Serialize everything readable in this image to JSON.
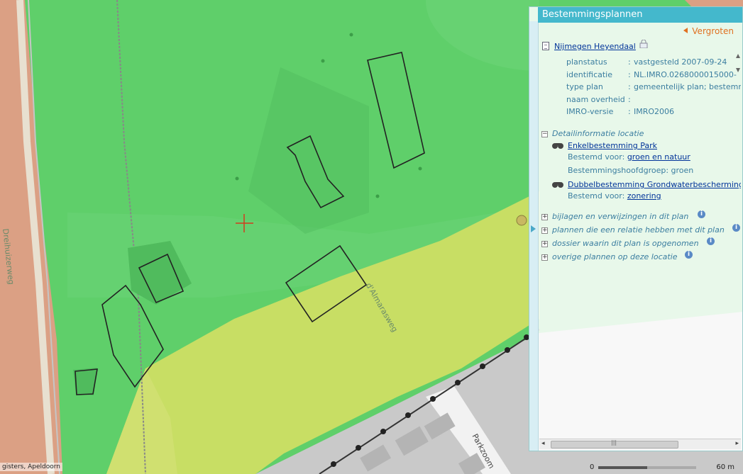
{
  "map": {
    "street_labels": [
      "Dreihuizerweg",
      "d'Almarasweg",
      "Parkzoom"
    ],
    "attribution": "gisters, Apeldoorn",
    "scale": {
      "start": "0",
      "end": "60 m"
    },
    "colors": {
      "park": "#5fcf6a",
      "road_band": "#55c868",
      "dubbel": "#c8de64",
      "residential": "#dba084",
      "road": "#c9c9c9"
    }
  },
  "panel": {
    "title": "Bestemmingsplannen",
    "expand_label": "Vergroten",
    "plan_name": "Nijmegen Heyendaal",
    "properties": [
      {
        "key": "planstatus",
        "sep": ":",
        "value": "vastgesteld 2007-09-24"
      },
      {
        "key": "identificatie",
        "sep": ":",
        "value": "NL.IMRO.0268000015000-"
      },
      {
        "key": "type plan",
        "sep": ":",
        "value": "gemeentelijk plan; bestemm"
      },
      {
        "key": "naam overheid",
        "sep": ":",
        "value": ""
      },
      {
        "key": "IMRO-versie",
        "sep": ":",
        "value": "IMRO2006"
      }
    ],
    "detail_section": {
      "toggle": "−",
      "title": "Detailinformatie locatie",
      "bestemmingen": [
        {
          "name": "Enkelbestemming Park",
          "rows": [
            {
              "label": "Bestemd voor:",
              "value": "groen en natuur",
              "link": true
            },
            {
              "label": "Bestemmingshoofdgroep:",
              "value": "groen",
              "link": false
            }
          ]
        },
        {
          "name": "Dubbelbestemming Grondwaterbeschermingsgebied",
          "rows": [
            {
              "label": "Bestemd voor:",
              "value": "zonering",
              "link": true
            }
          ]
        }
      ]
    },
    "collapsed_sections": [
      {
        "toggle": "+",
        "title": "bijlagen en verwijzingen in dit plan"
      },
      {
        "toggle": "+",
        "title": "plannen die een relatie hebben met dit plan"
      },
      {
        "toggle": "+",
        "title": "dossier waarin dit plan is opgenomen"
      },
      {
        "toggle": "+",
        "title": "overige plannen op deze locatie"
      }
    ],
    "info_glyph": "i",
    "scroll": {
      "left": "◂",
      "right": "▸",
      "thumb": "|||"
    }
  }
}
